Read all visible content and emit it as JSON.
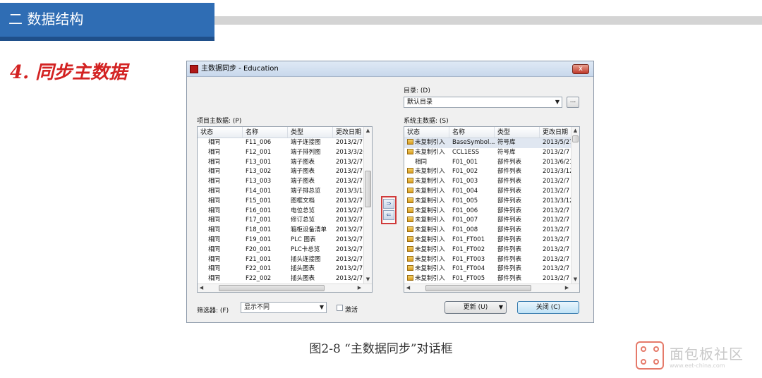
{
  "header": {
    "section_title": "二 数据结构",
    "heading": "4. 同步主数据"
  },
  "dialog": {
    "title": "主数据同步 - Education",
    "close_label": "x",
    "directory_label": "目录: (D)",
    "directory_value": "默认目录",
    "browse_label": "...",
    "project_label": "项目主数据: (P)",
    "system_label": "系统主数据: (S)",
    "columns": [
      "状态",
      "名称",
      "类型",
      "更改日期"
    ],
    "project_rows": [
      [
        "相同",
        "F11_006",
        "端子连接图",
        "2013/2/7 ."
      ],
      [
        "相同",
        "F12_001",
        "端子排列图",
        "2013/3/26"
      ],
      [
        "相同",
        "F13_001",
        "端子图表",
        "2013/2/7 ."
      ],
      [
        "相同",
        "F13_002",
        "端子图表",
        "2013/2/7 ."
      ],
      [
        "相同",
        "F13_003",
        "端子图表",
        "2013/2/7 ."
      ],
      [
        "相同",
        "F14_001",
        "端子排总览",
        "2013/3/12"
      ],
      [
        "相同",
        "F15_001",
        "图框文档",
        "2013/2/7 ."
      ],
      [
        "相同",
        "F16_001",
        "电位总览",
        "2013/2/7 ."
      ],
      [
        "相同",
        "F17_001",
        "修订总览",
        "2013/2/7 ."
      ],
      [
        "相同",
        "F18_001",
        "箱柜设备清单",
        "2013/2/7 ."
      ],
      [
        "相同",
        "F19_001",
        "PLC 图表",
        "2013/2/7 ."
      ],
      [
        "相同",
        "F20_001",
        "PLC卡总览",
        "2013/2/7 ."
      ],
      [
        "相同",
        "F21_001",
        "插头连接图",
        "2013/2/7 ."
      ],
      [
        "相同",
        "F22_001",
        "插头图表",
        "2013/2/7 ."
      ],
      [
        "相同",
        "F22_002",
        "插头图表",
        "2013/2/7 ."
      ]
    ],
    "system_rows": [
      [
        "未复制引入",
        "BaseSymbol...",
        "符号库",
        "2013/5/27"
      ],
      [
        "未复制引入",
        "CCL1ESS",
        "符号库",
        "2013/2/7 ."
      ],
      [
        "相同",
        "F01_001",
        "部件列表",
        "2013/6/21"
      ],
      [
        "未复制引入",
        "F01_002",
        "部件列表",
        "2013/3/12"
      ],
      [
        "未复制引入",
        "F01_003",
        "部件列表",
        "2013/2/7 ."
      ],
      [
        "未复制引入",
        "F01_004",
        "部件列表",
        "2013/2/7 ."
      ],
      [
        "未复制引入",
        "F01_005",
        "部件列表",
        "2013/3/12"
      ],
      [
        "未复制引入",
        "F01_006",
        "部件列表",
        "2013/2/7 ."
      ],
      [
        "未复制引入",
        "F01_007",
        "部件列表",
        "2013/2/7 ."
      ],
      [
        "未复制引入",
        "F01_008",
        "部件列表",
        "2013/2/7 ."
      ],
      [
        "未复制引入",
        "F01_FT001",
        "部件列表",
        "2013/2/7 ."
      ],
      [
        "未复制引入",
        "F01_FT002",
        "部件列表",
        "2013/2/7 ."
      ],
      [
        "未复制引入",
        "F01_FT003",
        "部件列表",
        "2013/2/7 ."
      ],
      [
        "未复制引入",
        "F01_FT004",
        "部件列表",
        "2013/2/7 ."
      ],
      [
        "未复制引入",
        "F01_FT005",
        "部件列表",
        "2013/2/7 ."
      ]
    ],
    "copy_right_label": "⇒",
    "copy_left_label": "⇐",
    "filter_label": "筛选器: (F)",
    "filter_value": "显示不同",
    "activate_label": "激活",
    "update_label": "更新 (U)",
    "close_button_label": "关闭 (C)"
  },
  "caption": "图2-8 “主数据同步”对话框",
  "watermark": {
    "name": "面包板社区",
    "sub": "www.eet-china.com"
  },
  "colors": {
    "header_blue": "#2f6db4",
    "heading_red": "#d32222",
    "highlight": "#d03a3a"
  }
}
